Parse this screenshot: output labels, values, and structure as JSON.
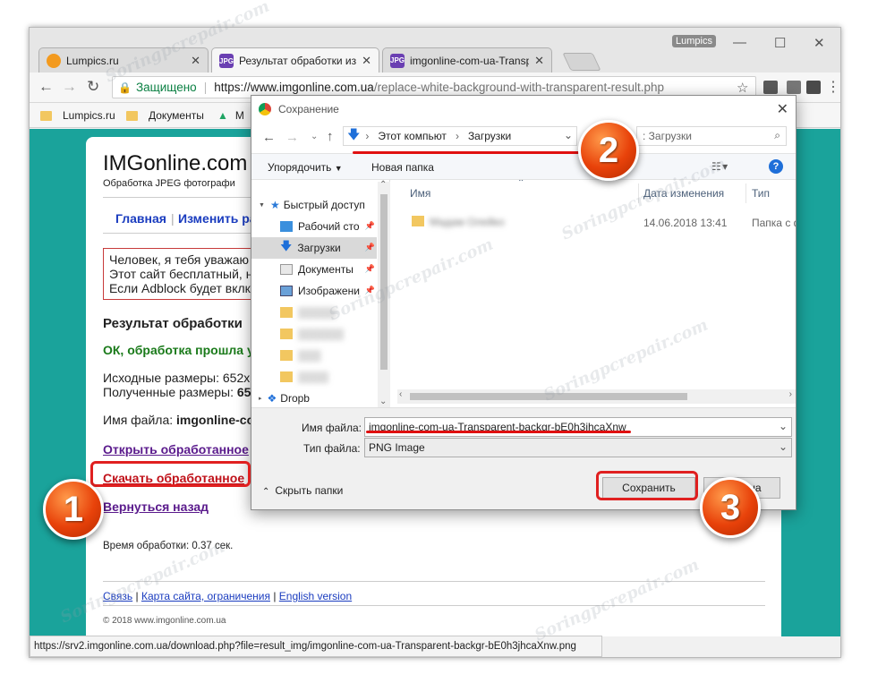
{
  "browser": {
    "user": "Lumpics",
    "tabs": [
      {
        "title": "Lumpics.ru",
        "icon": "lumpics-favicon"
      },
      {
        "title": "Результат обработки из",
        "icon": "jpg-favicon",
        "active": true
      },
      {
        "title": "imgonline-com-ua-Transp",
        "icon": "jpg-favicon"
      }
    ],
    "secure_label": "Защищено",
    "url_main": "https://www.imgonline.com.ua",
    "url_rest": "/replace-white-background-with-transparent-result.php",
    "bookmarks": [
      "Lumpics.ru",
      "Документы",
      "M"
    ],
    "status_url": "https://srv2.imgonline.com.ua/download.php?file=result_img/imgonline-com-ua-Transparent-backgr-bE0h3jhcaXnw.png"
  },
  "page": {
    "logo": "IMGonline.com",
    "tagline": "Обработка JPEG фотографи",
    "nav": [
      "Главная",
      "Изменить ра"
    ],
    "notice": [
      "Человек, я тебя уважаю",
      "Этот сайт бесплатный, н",
      "Если Adblock будет вклк"
    ],
    "result_heading": "Результат обработки",
    "ok_text": "ОК, обработка прошла у",
    "source_size": "Исходные размеры: 652х",
    "result_size_label": "Полученные размеры:",
    "result_size_value": "65",
    "filename_label": "Имя файла:",
    "filename_value": "imgonline-co",
    "links": {
      "open": "Открыть обработанное",
      "download": "Скачать обработанное",
      "back": "Вернуться назад"
    },
    "time": "Время обработки: 0.37 сек.",
    "footer_links": [
      "Связь",
      "Карта сайта, ограничения",
      "English version"
    ],
    "copyright": "© 2018 www.imgonline.com.ua"
  },
  "dialog": {
    "title": "Сохранение",
    "path": [
      "Этот компьют",
      "Загрузки"
    ],
    "search_placeholder": ": Загрузки",
    "organize": "Упорядочить",
    "new_folder": "Новая папка",
    "nav_items": [
      {
        "label": "Быстрый доступ",
        "icon": "star-icon"
      },
      {
        "label": "Рабочий сто",
        "icon": "desktop-icon"
      },
      {
        "label": "Загрузки",
        "icon": "download-icon",
        "selected": true
      },
      {
        "label": "Документы",
        "icon": "documents-icon"
      },
      {
        "label": "Изображени",
        "icon": "pictures-icon"
      },
      {
        "label": "Dropb",
        "icon": "dropbox-icon"
      }
    ],
    "columns": [
      "Имя",
      "Дата изменения",
      "Тип"
    ],
    "file": {
      "name": "Мадам Олейко",
      "date": "14.06.2018 13:41",
      "type": "Папка с ф"
    },
    "filename_label": "Имя файла:",
    "filename_value": "imgonline-com-ua-Transparent-backgr-bE0h3jhcaXnw",
    "filetype_label": "Тип файла:",
    "filetype_value": "PNG Image",
    "hide_folders": "Скрыть папки",
    "save": "Сохранить",
    "cancel": "Отмена"
  },
  "annotations": {
    "steps": [
      "1",
      "2",
      "3"
    ],
    "highlight_color": "#e01010"
  },
  "watermark": "Soringpcrepair.com",
  "colors": {
    "viewport_bg": "#1aa39b",
    "link_blue": "#1a3cbf",
    "link_purple": "#5a1a8c",
    "ok_green": "#1a7a1a"
  }
}
